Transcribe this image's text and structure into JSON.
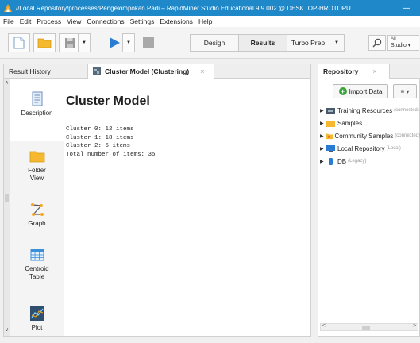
{
  "window": {
    "title": "//Local Repository/processes/Pengelompokan Padi – RapidMiner Studio Educational 9.9.002 @ DESKTOP-HROTOPU",
    "minimize": "—"
  },
  "menu": [
    "File",
    "Edit",
    "Process",
    "View",
    "Connections",
    "Settings",
    "Extensions",
    "Help"
  ],
  "perspectives": {
    "design": "Design",
    "results": "Results",
    "turbo_prep": "Turbo Prep",
    "studio_line1": "All",
    "studio_line2": "Studio ▾"
  },
  "tabs": {
    "result_history": "Result History",
    "cluster_model": "Cluster Model (Clustering)",
    "close": "×"
  },
  "side_views": [
    {
      "label": "Description"
    },
    {
      "label": "Folder\nView"
    },
    {
      "label": "Graph"
    },
    {
      "label": "Centroid\nTable"
    },
    {
      "label": "Plot"
    }
  ],
  "content": {
    "title": "Cluster Model",
    "lines": [
      "Cluster 0: 12 items",
      "Cluster 1: 18 items",
      "Cluster 2: 5 items",
      "Total number of items: 35"
    ]
  },
  "repository": {
    "tab_label": "Repository",
    "import_button": "Import Data",
    "menu_button": "≡ ▾",
    "items": [
      {
        "label": "Training Resources",
        "note": "(connected)",
        "icon": "training-icon"
      },
      {
        "label": "Samples",
        "note": "",
        "icon": "folder-icon"
      },
      {
        "label": "Community Samples",
        "note": "(connected)",
        "icon": "community-icon"
      },
      {
        "label": "Local Repository",
        "note": "(Local)",
        "icon": "local-repo-icon"
      },
      {
        "label": "DB",
        "note": "(Legacy)",
        "icon": "db-icon"
      }
    ]
  },
  "colors": {
    "titlebar": "#1e88c8",
    "accent_blue": "#2a7bd4",
    "folder_yellow": "#f5b82e"
  }
}
